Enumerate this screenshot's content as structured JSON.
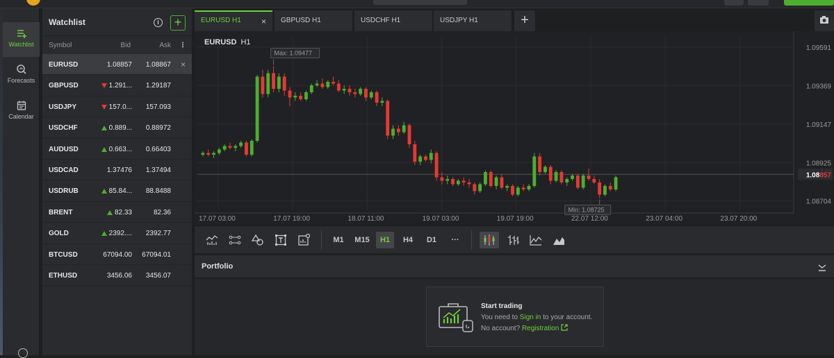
{
  "nav": {
    "items": [
      {
        "label": "Watchlist",
        "icon": "watchlist-icon",
        "active": true
      },
      {
        "label": "Forecasts",
        "icon": "forecasts-icon",
        "active": false
      },
      {
        "label": "Calendar",
        "icon": "calendar-icon",
        "active": false
      }
    ]
  },
  "watchlist": {
    "title": "Watchlist",
    "info_glyph": "i",
    "add_glyph": "+",
    "columns": {
      "symbol": "Symbol",
      "bid": "Bid",
      "ask": "Ask",
      "more": "⋮"
    },
    "rows": [
      {
        "symbol": "EURUSD",
        "bid": "1.08857",
        "ask": "1.08867",
        "trend": "none",
        "selected": true,
        "close": "×"
      },
      {
        "symbol": "GBPUSD",
        "bid": "1.291...",
        "ask": "1.29187",
        "trend": "down"
      },
      {
        "symbol": "USDJPY",
        "bid": "157.0...",
        "ask": "157.093",
        "trend": "down"
      },
      {
        "symbol": "USDCHF",
        "bid": "0.889...",
        "ask": "0.88972",
        "trend": "up"
      },
      {
        "symbol": "AUDUSD",
        "bid": "0.663...",
        "ask": "0.66403",
        "trend": "up"
      },
      {
        "symbol": "USDCAD",
        "bid": "1.37476",
        "ask": "1.37494",
        "trend": "none"
      },
      {
        "symbol": "USDRUB",
        "bid": "85.84...",
        "ask": "88.8488",
        "trend": "up"
      },
      {
        "symbol": "BRENT",
        "bid": "82.33",
        "ask": "82.36",
        "trend": "up"
      },
      {
        "symbol": "GOLD",
        "bid": "2392....",
        "ask": "2392.77",
        "trend": "up"
      },
      {
        "symbol": "BTCUSD",
        "bid": "67094.00",
        "ask": "67094.01",
        "trend": "none"
      },
      {
        "symbol": "ETHUSD",
        "bid": "3456.06",
        "ask": "3456.07",
        "trend": "none"
      }
    ]
  },
  "tabs": [
    {
      "label": "EURUSD H1",
      "active": true,
      "close": "×"
    },
    {
      "label": "GBPUSD H1",
      "active": false
    },
    {
      "label": "USDCHF H1",
      "active": false
    },
    {
      "label": "USDJPY H1",
      "active": false
    }
  ],
  "tab_add_glyph": "+",
  "chart": {
    "symbol": "EURUSD",
    "timeframe": "H1",
    "max_label": "Max: 1.09477",
    "min_label": "Min: 1.08725",
    "current_price_a": "1.08",
    "current_price_b": "857",
    "price_labels": [
      "1.09591",
      "1.09369",
      "1.09147",
      "1.08925",
      "1.08704"
    ],
    "time_labels": [
      "17.07 03:00",
      "17.07 19:00",
      "18.07 11:00",
      "19.07 03:00",
      "19.07 19:00",
      "22.07 12:00",
      "23.07 04:00",
      "23.07 20:00"
    ]
  },
  "chart_data": {
    "type": "candlestick",
    "title": "EURUSD H1",
    "ylim": [
      1.0865,
      1.0965
    ],
    "y_ticks": [
      1.09591,
      1.09369,
      1.09147,
      1.08925,
      1.08704
    ],
    "x_tick_labels": [
      "17.07 03:00",
      "17.07 19:00",
      "18.07 11:00",
      "19.07 03:00",
      "19.07 19:00",
      "22.07 12:00",
      "23.07 04:00",
      "23.07 20:00"
    ],
    "max": 1.09477,
    "min": 1.08725,
    "last": 1.08857,
    "up_color": "#4caf2f",
    "down_color": "#e53935",
    "candles": [
      [
        1.0897,
        1.0899,
        1.0896,
        1.0898
      ],
      [
        1.0898,
        1.09,
        1.0896,
        1.0897
      ],
      [
        1.0897,
        1.0899,
        1.0895,
        1.0898
      ],
      [
        1.0898,
        1.0901,
        1.0897,
        1.09
      ],
      [
        1.09,
        1.0903,
        1.0899,
        1.0902
      ],
      [
        1.0902,
        1.0904,
        1.09,
        1.0901
      ],
      [
        1.0901,
        1.0903,
        1.0899,
        1.0902
      ],
      [
        1.0902,
        1.0905,
        1.0901,
        1.0904
      ],
      [
        1.0904,
        1.0905,
        1.0896,
        1.0897
      ],
      [
        1.0897,
        1.0906,
        1.0896,
        1.0905
      ],
      [
        1.0905,
        1.0943,
        1.0904,
        1.0942
      ],
      [
        1.0942,
        1.0946,
        1.093,
        1.0932
      ],
      [
        1.0932,
        1.0946,
        1.093,
        1.0944
      ],
      [
        1.0944,
        1.0948,
        1.0933,
        1.0935
      ],
      [
        1.0935,
        1.0944,
        1.0933,
        1.0942
      ],
      [
        1.0942,
        1.0944,
        1.0931,
        1.0934
      ],
      [
        1.0934,
        1.0936,
        1.0925,
        1.093
      ],
      [
        1.093,
        1.0933,
        1.0928,
        1.0931
      ],
      [
        1.0931,
        1.0933,
        1.0928,
        1.0929
      ],
      [
        1.0929,
        1.0934,
        1.0928,
        1.0933
      ],
      [
        1.0933,
        1.0938,
        1.0932,
        1.0937
      ],
      [
        1.0937,
        1.094,
        1.0936,
        1.0938
      ],
      [
        1.0938,
        1.0941,
        1.0935,
        1.0936
      ],
      [
        1.0936,
        1.094,
        1.0935,
        1.0939
      ],
      [
        1.0939,
        1.0942,
        1.0937,
        1.0938
      ],
      [
        1.0938,
        1.094,
        1.0933,
        1.0934
      ],
      [
        1.0934,
        1.0937,
        1.0932,
        1.0935
      ],
      [
        1.0935,
        1.0937,
        1.0931,
        1.0933
      ],
      [
        1.0933,
        1.0935,
        1.093,
        1.0932
      ],
      [
        1.0932,
        1.0936,
        1.0931,
        1.0935
      ],
      [
        1.0935,
        1.0936,
        1.0928,
        1.093
      ],
      [
        1.093,
        1.0934,
        1.0929,
        1.0933
      ],
      [
        1.0933,
        1.0934,
        1.0925,
        1.0927
      ],
      [
        1.0927,
        1.093,
        1.0925,
        1.0928
      ],
      [
        1.0928,
        1.0929,
        1.0906,
        1.0908
      ],
      [
        1.0908,
        1.0914,
        1.0906,
        1.0912
      ],
      [
        1.0912,
        1.0914,
        1.0908,
        1.091
      ],
      [
        1.091,
        1.0916,
        1.0909,
        1.0914
      ],
      [
        1.0914,
        1.0915,
        1.0901,
        1.0903
      ],
      [
        1.0903,
        1.0905,
        1.0891,
        1.0893
      ],
      [
        1.0893,
        1.0897,
        1.0891,
        1.0896
      ],
      [
        1.0896,
        1.0897,
        1.0893,
        1.0894
      ],
      [
        1.0894,
        1.09,
        1.0892,
        1.0898
      ],
      [
        1.0898,
        1.0899,
        1.0882,
        1.0884
      ],
      [
        1.0884,
        1.0887,
        1.088,
        1.0882
      ],
      [
        1.0882,
        1.0885,
        1.088,
        1.0883
      ],
      [
        1.0883,
        1.0884,
        1.0879,
        1.088
      ],
      [
        1.088,
        1.0883,
        1.0879,
        1.0882
      ],
      [
        1.0882,
        1.0884,
        1.0879,
        1.0881
      ],
      [
        1.0881,
        1.0883,
        1.0878,
        1.088
      ],
      [
        1.088,
        1.0881,
        1.0874,
        1.0876
      ],
      [
        1.0876,
        1.0881,
        1.0875,
        1.088
      ],
      [
        1.088,
        1.0888,
        1.0879,
        1.0887
      ],
      [
        1.0887,
        1.0888,
        1.0878,
        1.0879
      ],
      [
        1.0879,
        1.0885,
        1.0877,
        1.0884
      ],
      [
        1.0884,
        1.0886,
        1.0877,
        1.0878
      ],
      [
        1.0878,
        1.088,
        1.0876,
        1.0879
      ],
      [
        1.0879,
        1.088,
        1.0873,
        1.0874
      ],
      [
        1.0874,
        1.0879,
        1.0873,
        1.0878
      ],
      [
        1.0878,
        1.088,
        1.0876,
        1.0877
      ],
      [
        1.0877,
        1.088,
        1.0876,
        1.0879
      ],
      [
        1.0879,
        1.0898,
        1.0878,
        1.0896
      ],
      [
        1.0896,
        1.0898,
        1.0885,
        1.0887
      ],
      [
        1.0887,
        1.0891,
        1.0886,
        1.089
      ],
      [
        1.089,
        1.0891,
        1.088,
        1.0882
      ],
      [
        1.0882,
        1.0888,
        1.0881,
        1.0887
      ],
      [
        1.0887,
        1.0888,
        1.088,
        1.0881
      ],
      [
        1.0881,
        1.0884,
        1.0879,
        1.0883
      ],
      [
        1.0883,
        1.0886,
        1.0882,
        1.0885
      ],
      [
        1.0885,
        1.0886,
        1.0877,
        1.0878
      ],
      [
        1.0878,
        1.0886,
        1.0877,
        1.0885
      ],
      [
        1.0885,
        1.0889,
        1.0882,
        1.0883
      ],
      [
        1.0883,
        1.0885,
        1.088,
        1.0881
      ],
      [
        1.0881,
        1.0883,
        1.0872,
        1.0874
      ],
      [
        1.0874,
        1.088,
        1.0873,
        1.0879
      ],
      [
        1.0879,
        1.0881,
        1.0876,
        1.0877
      ],
      [
        1.0877,
        1.0885,
        1.0876,
        1.0884
      ]
    ]
  },
  "toolbar": {
    "timeframes": [
      "M1",
      "M15",
      "H1",
      "H4",
      "D1"
    ],
    "active_timeframe": "H1",
    "more": "···"
  },
  "portfolio": {
    "title": "Portfolio",
    "card_title": "Start trading",
    "line1_pre": "You need to ",
    "line1_link": "Sign in",
    "line1_post": " to your account.",
    "line2_pre": "No account? ",
    "line2_link": "Registration"
  }
}
